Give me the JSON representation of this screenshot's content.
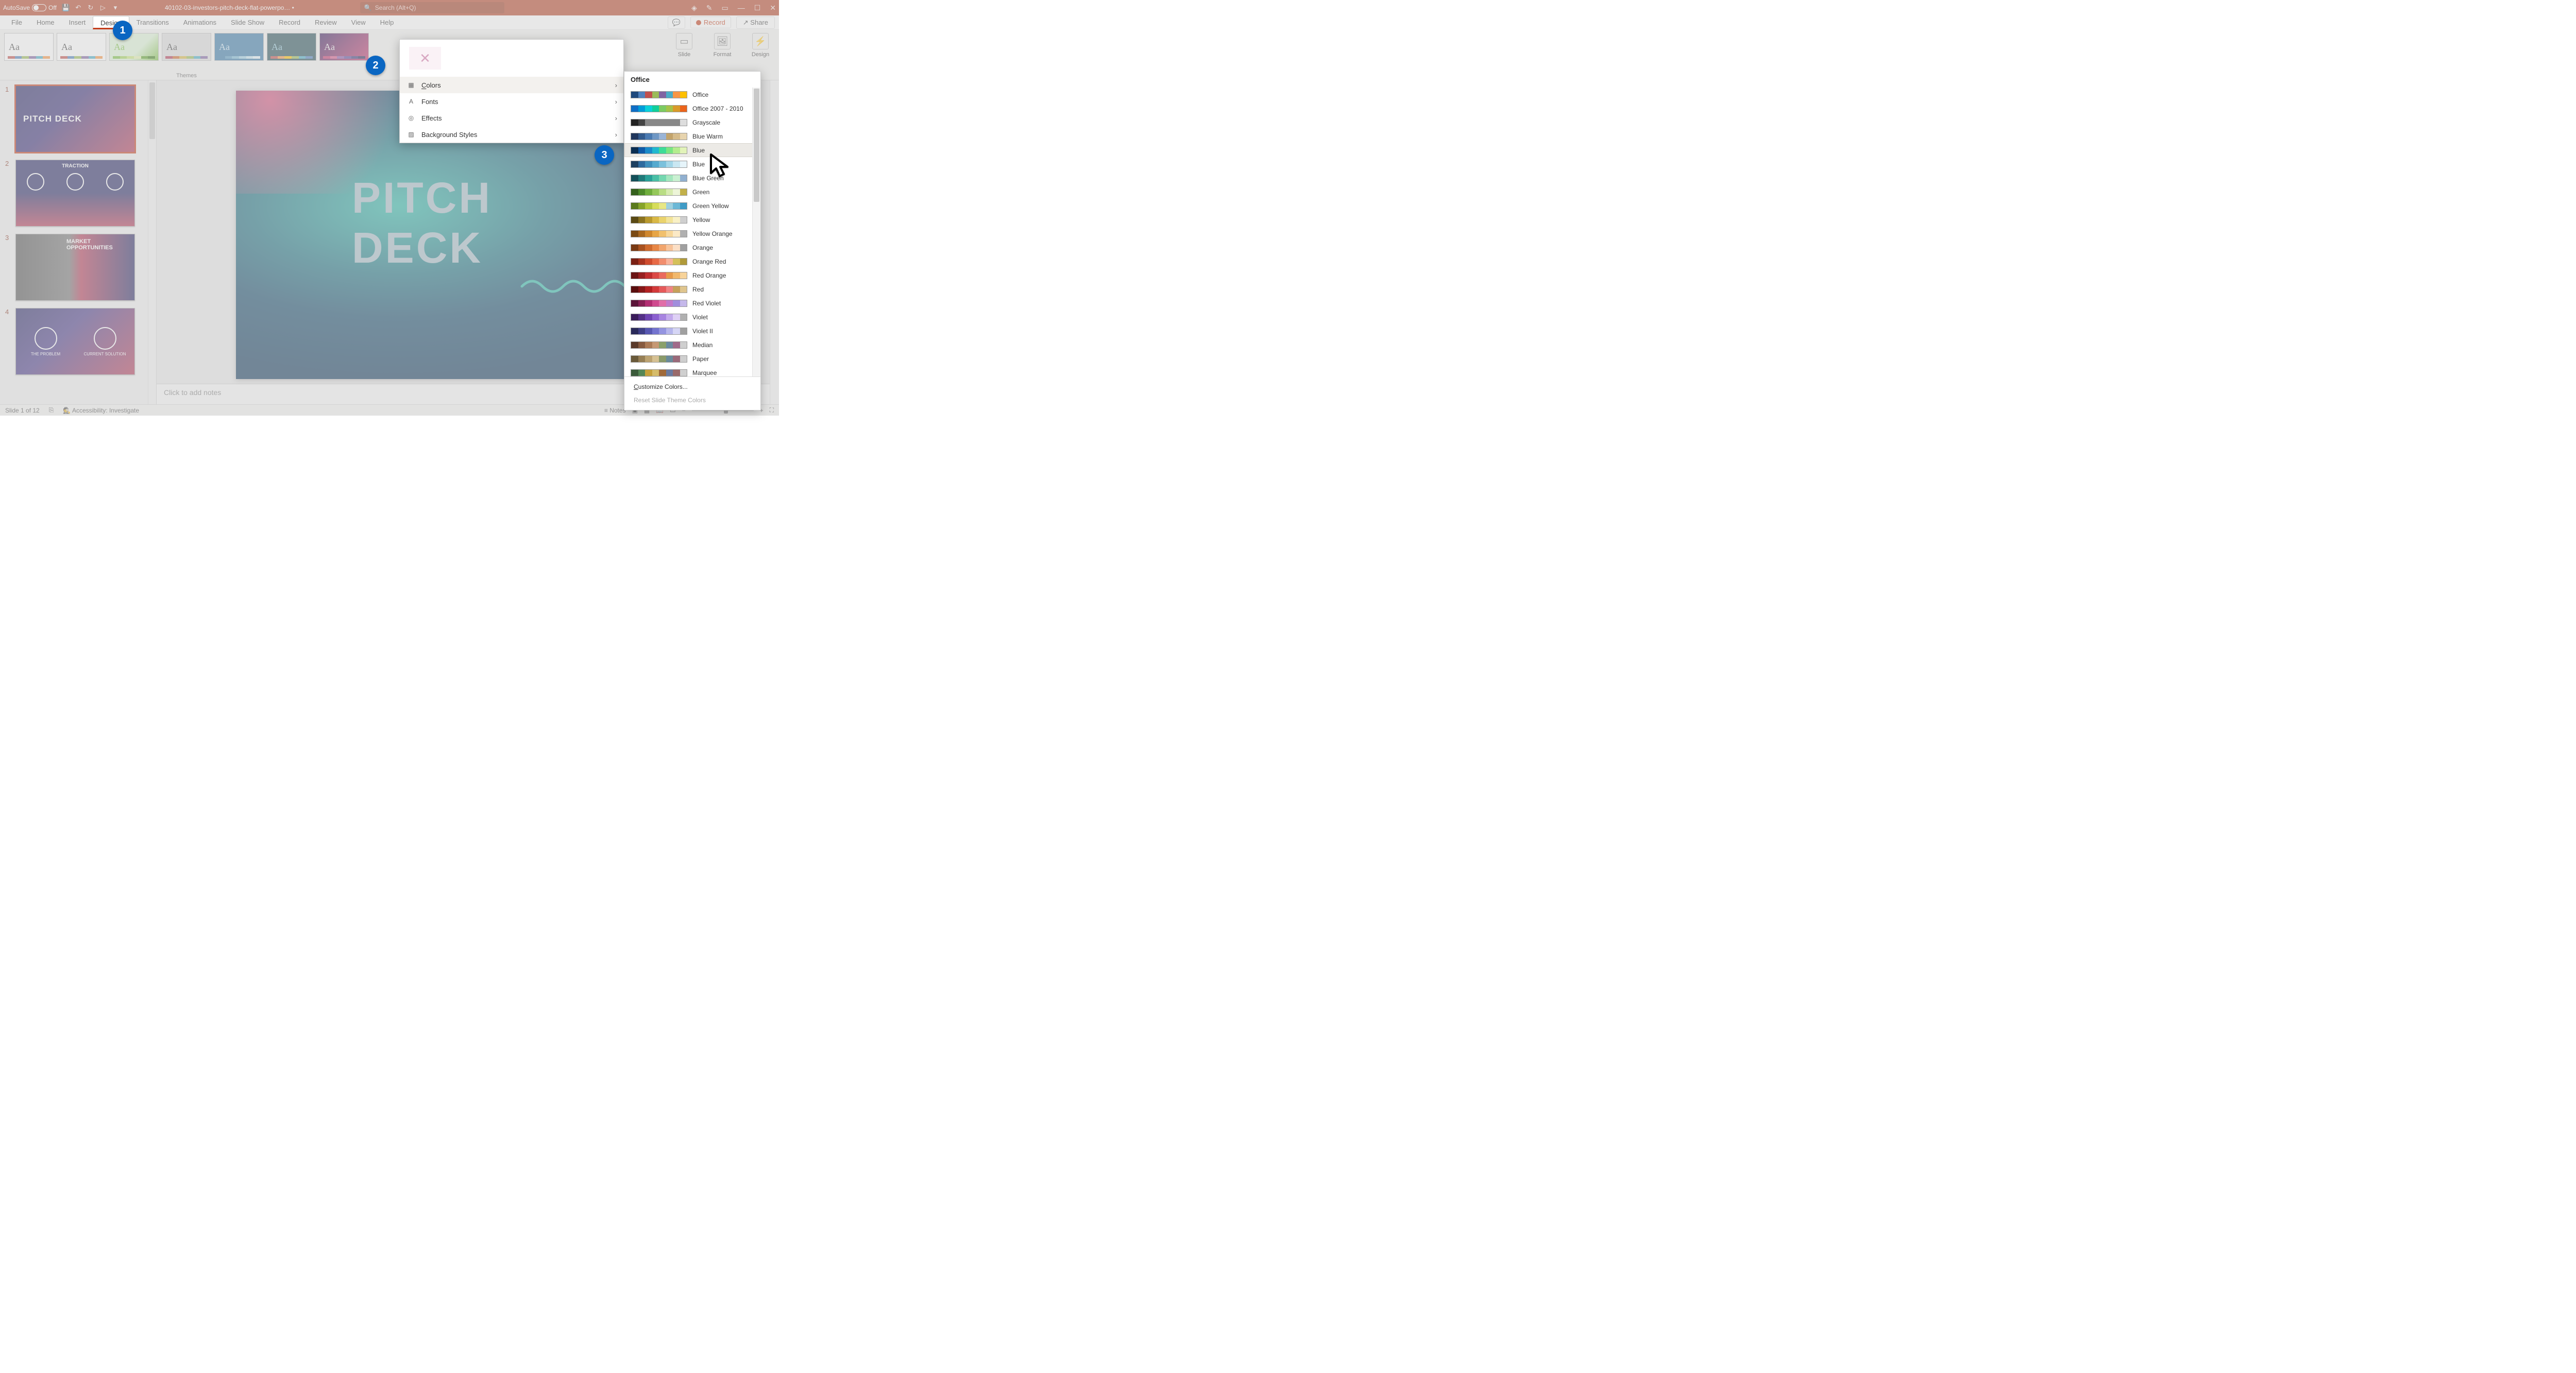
{
  "titlebar": {
    "autosave_label": "AutoSave",
    "autosave_state": "Off",
    "doc_title": "40102-03-investors-pitch-deck-flat-powerpo… •",
    "search_placeholder": "Search (Alt+Q)"
  },
  "ribbon_tabs": {
    "file": "File",
    "home": "Home",
    "insert": "Insert",
    "design": "Design",
    "transitions": "Transitions",
    "animations": "Animations",
    "slideshow": "Slide Show",
    "record": "Record",
    "review": "Review",
    "view": "View",
    "help": "Help",
    "record_btn": "Record",
    "share_btn": "Share"
  },
  "ribbon": {
    "themes_label": "Themes",
    "slide_size": "Slide",
    "format_bg": "Format",
    "design_ideas": "Design"
  },
  "variants_menu": {
    "colors": "Colors",
    "fonts": "Fonts",
    "effects": "Effects",
    "bgstyles": "Background Styles"
  },
  "color_flyout": {
    "header": "Office",
    "schemes": [
      {
        "name": "Office",
        "cls": "c-office"
      },
      {
        "name": "Office 2007 - 2010",
        "cls": "c-off2007"
      },
      {
        "name": "Grayscale",
        "cls": "c-gray"
      },
      {
        "name": "Blue Warm",
        "cls": "c-bluewarm"
      },
      {
        "name": "Blue",
        "cls": "c-blue",
        "hover": true
      },
      {
        "name": "Blue",
        "cls": "c-blue2"
      },
      {
        "name": "Blue Green",
        "cls": "c-bluegreen"
      },
      {
        "name": "Green",
        "cls": "c-green"
      },
      {
        "name": "Green Yellow",
        "cls": "c-greenyellow"
      },
      {
        "name": "Yellow",
        "cls": "c-yellow"
      },
      {
        "name": "Yellow Orange",
        "cls": "c-yelor"
      },
      {
        "name": "Orange",
        "cls": "c-orange"
      },
      {
        "name": "Orange Red",
        "cls": "c-orred"
      },
      {
        "name": "Red Orange",
        "cls": "c-redor"
      },
      {
        "name": "Red",
        "cls": "c-red"
      },
      {
        "name": "Red Violet",
        "cls": "c-redvio"
      },
      {
        "name": "Violet",
        "cls": "c-violet"
      },
      {
        "name": "Violet II",
        "cls": "c-violet2"
      },
      {
        "name": "Median",
        "cls": "c-median"
      },
      {
        "name": "Paper",
        "cls": "c-paper"
      },
      {
        "name": "Marquee",
        "cls": "c-marquee"
      }
    ],
    "customize": "Customize Colors...",
    "reset": "Reset Slide Theme Colors"
  },
  "thumbs": {
    "s1_title": "PITCH DECK",
    "s2_title": "TRACTION",
    "s3_title": "MARKET OPPORTUNITIES",
    "s4_left": "THE PROBLEM",
    "s4_right": "CURRENT SOLUTION"
  },
  "canvas": {
    "title": "PITCH DECK"
  },
  "notes_placeholder": "Click to add notes",
  "statusbar": {
    "slide_count": "Slide 1 of 12",
    "accessibility": "Accessibility: Investigate",
    "notes_btn": "Notes"
  },
  "badges": {
    "b1": "1",
    "b2": "2",
    "b3": "3"
  }
}
